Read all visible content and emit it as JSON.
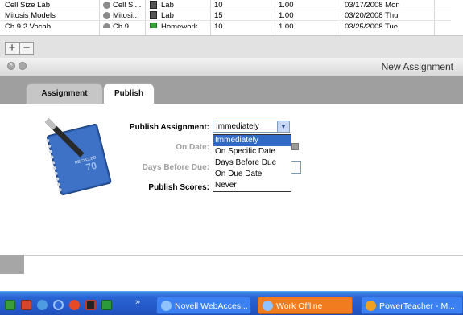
{
  "assignments_table": {
    "rows": [
      {
        "name": "Cell Size Lab",
        "short": "Cell Si...",
        "category": "Lab",
        "points": "10",
        "weight": "1.00",
        "due": "03/17/2008 Mon"
      },
      {
        "name": "Mitosis Models",
        "short": "Mitosi...",
        "category": "Lab",
        "points": "15",
        "weight": "1.00",
        "due": "03/20/2008 Thu"
      },
      {
        "name": "Ch 9.2 Vocab",
        "short": "Ch 9...",
        "category": "Homework",
        "points": "10",
        "weight": "1.00",
        "due": "03/25/2008 Tue"
      }
    ],
    "add_label": "+",
    "remove_label": "−"
  },
  "dialog": {
    "title": "New Assignment",
    "tabs": [
      {
        "label": "Assignment",
        "active": false
      },
      {
        "label": "Publish",
        "active": true
      }
    ],
    "form": {
      "publish_assignment_label": "Publish Assignment:",
      "publish_assignment_value": "Immediately",
      "on_date_label": "On Date:",
      "days_before_due_label": "Days Before Due:",
      "publish_scores_label": "Publish Scores:",
      "dropdown_options": [
        "Immediately",
        "On Specific Date",
        "Days Before Due",
        "On Due Date",
        "Never"
      ],
      "selected_option": "Immediately"
    },
    "notebook_brand": "RECYCLED",
    "notebook_number": "70"
  },
  "taskbar": {
    "chevron": "»",
    "buttons": [
      {
        "label": "Novell WebAcces...",
        "color": "#3c81f3"
      },
      {
        "label": "Work Offline",
        "color": "#f07c1f"
      },
      {
        "label": "PowerTeacher - M...",
        "color": "#3c81f3"
      }
    ]
  },
  "colors": {
    "taskbar": "#2458c8",
    "selection": "#316ac5",
    "active_task": "#f07c1f"
  }
}
